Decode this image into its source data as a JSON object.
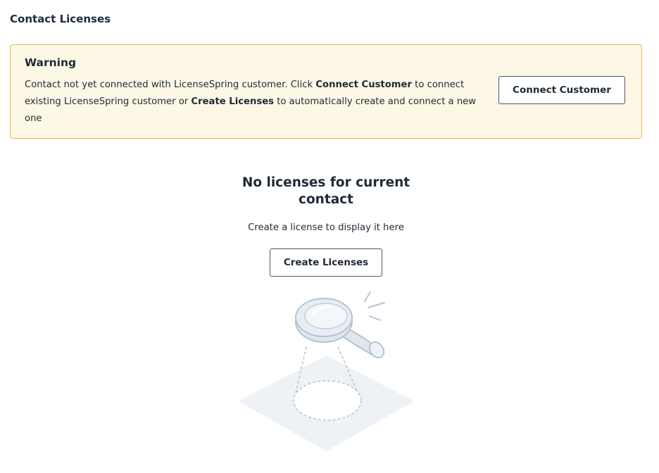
{
  "page": {
    "title": "Contact Licenses"
  },
  "warning": {
    "title": "Warning",
    "text_part1": "Contact not yet connected with LicenseSpring customer. Click ",
    "text_bold1": "Connect Customer",
    "text_part2": " to connect existing LicenseSpring customer or ",
    "text_bold2": "Create Licenses",
    "text_part3": " to automatically create and connect a new one",
    "button_label": "Connect Customer",
    "background_color": "#fdf7e6",
    "border_color": "#e3b94a"
  },
  "empty_state": {
    "title": "No licenses for current contact",
    "subtitle": "Create a license to display it here",
    "button_label": "Create Licenses",
    "illustration_icon": "magnifying-glass-search-icon"
  }
}
